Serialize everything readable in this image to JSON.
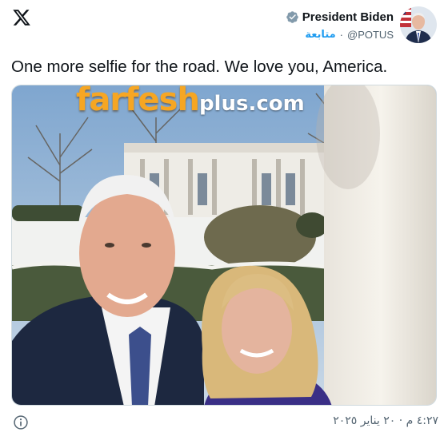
{
  "header": {
    "logo_icon": "x-logo-icon",
    "display_name": "President Biden",
    "verified_icon": "verified-badge-icon",
    "follow_label": "متابعة",
    "separator": "·",
    "handle": "@POTUS"
  },
  "tweet": {
    "text": "One more selfie for the road. We love you, America.",
    "timestamp": "٤:٢٧ م · ٢٠ يناير ٢٠٢٥"
  },
  "media": {
    "watermark_brand": "farfesh",
    "watermark_suffix": "plus.com"
  },
  "footer": {
    "info_icon": "info-icon"
  },
  "colors": {
    "accent": "#1d9bf0",
    "text": "#0f1419",
    "muted": "#536471",
    "border": "#cfd9de",
    "watermark": "#f6a623"
  }
}
